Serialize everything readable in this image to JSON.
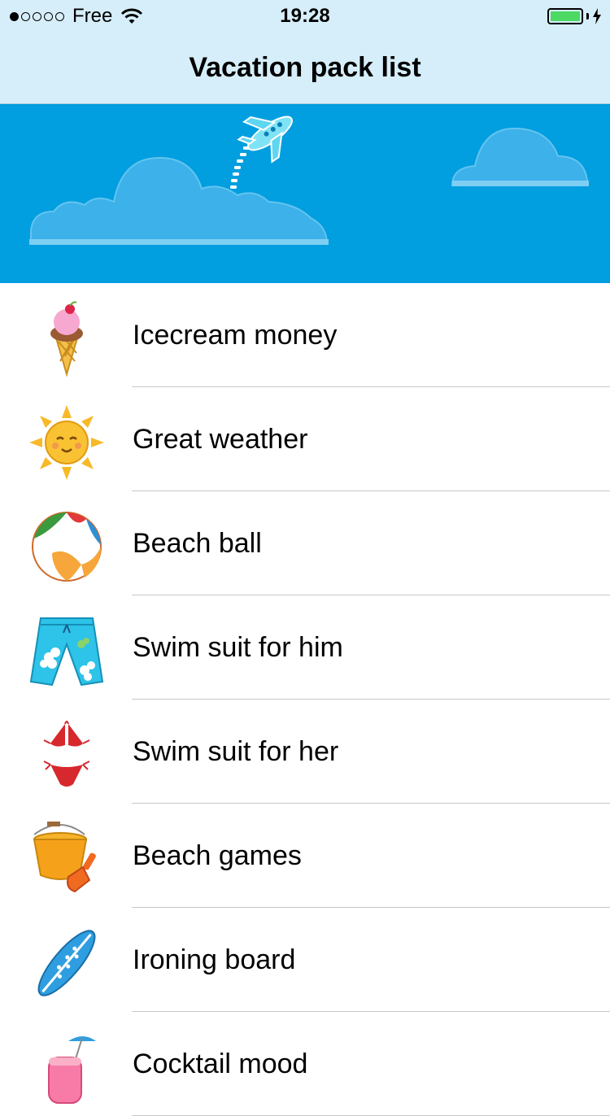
{
  "status_bar": {
    "carrier": "Free",
    "time": "19:28",
    "signal_bars_filled": 1,
    "signal_bars_total": 5,
    "battery_charging": true
  },
  "navbar": {
    "title": "Vacation pack list",
    "background": "#d6eef9"
  },
  "banner": {
    "background": "#019ee0",
    "icons": [
      "airplane-icon",
      "cloud-icon"
    ]
  },
  "list": {
    "items": [
      {
        "label": "Icecream money",
        "icon": "icecream-icon"
      },
      {
        "label": "Great weather",
        "icon": "sun-icon"
      },
      {
        "label": "Beach ball",
        "icon": "beach-ball-icon"
      },
      {
        "label": "Swim suit for him",
        "icon": "swim-shorts-icon"
      },
      {
        "label": "Swim suit for her",
        "icon": "bikini-icon"
      },
      {
        "label": "Beach games",
        "icon": "bucket-spade-icon"
      },
      {
        "label": "Ironing board",
        "icon": "surfboard-icon"
      },
      {
        "label": "Cocktail mood",
        "icon": "cocktail-icon"
      }
    ]
  }
}
